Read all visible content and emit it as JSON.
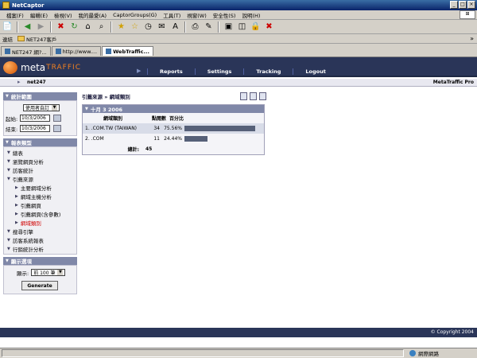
{
  "window": {
    "title": "NetCaptor",
    "buttons": [
      "_",
      "□",
      "×"
    ]
  },
  "menu": [
    "檔案(F)",
    "編輯(E)",
    "檢視(V)",
    "我的最愛(A)",
    "CaptorGroups(G)",
    "工具(T)",
    "視窗(W)",
    "安全性(S)",
    "說明(H)"
  ],
  "toolbar_icons": [
    "new-doc-icon",
    "back-icon",
    "forward-icon",
    "stop-icon",
    "refresh-icon",
    "home-icon",
    "search-icon",
    "favorites-icon",
    "add-favorite-icon",
    "history-icon",
    "mail-icon",
    "font-icon",
    "print-icon",
    "edit-icon",
    "window-icon",
    "lock-icon",
    "close-icon"
  ],
  "linkbar": {
    "label": "連結",
    "folder": "NET247客戶"
  },
  "tabs": [
    {
      "label": "NET247 網?..."
    },
    {
      "label": "http://www...."
    },
    {
      "label": "WebTraffic..."
    }
  ],
  "app": {
    "logo_meta": "meta",
    "logo_traffic": "TRAFFIC",
    "nav": [
      "Reports",
      "Settings",
      "Tracking",
      "Logout"
    ],
    "org": "net247",
    "product": "MetaTraffic Pro"
  },
  "sidebar": {
    "stats_header": "統計範圍",
    "range_select": "使用者自訂",
    "start_label": "起始:",
    "start_date": "10/3/2006",
    "end_label": "結束:",
    "end_date": "10/3/2006",
    "report_header": "報表類型",
    "items": [
      {
        "label": "總表",
        "level": 0,
        "active": false
      },
      {
        "label": "瀏覽網頁分析",
        "level": 0,
        "active": false
      },
      {
        "label": "訪客統計",
        "level": 0,
        "active": false
      },
      {
        "label": "引薦來源",
        "level": 0,
        "active": false
      },
      {
        "label": "主要網域分析",
        "level": 1,
        "active": false
      },
      {
        "label": "網域主機分析",
        "level": 1,
        "active": false
      },
      {
        "label": "引薦網頁",
        "level": 1,
        "active": false
      },
      {
        "label": "引薦網頁(含參數)",
        "level": 1,
        "active": false
      },
      {
        "label": "網域類別",
        "level": 1,
        "active": true
      },
      {
        "label": "搜尋引擎",
        "level": 0,
        "active": false
      },
      {
        "label": "訪客系統報表",
        "level": 0,
        "active": false
      },
      {
        "label": "行銷統計分析",
        "level": 0,
        "active": false
      }
    ],
    "display_header": "顯示選項",
    "display_label": "顯示:",
    "display_select": "前 100 筆",
    "generate": "Generate"
  },
  "main": {
    "breadcrumb": "引薦來源 » 網域類別",
    "panel_title": "十月 3 2006",
    "col_domain": "網域類別",
    "col_hits": "點閱數",
    "col_pct": "百分比",
    "rows": [
      {
        "index": "1.",
        "domain": ".COM.TW (TAIWAN)",
        "hits": "34",
        "pct": "75.56%",
        "ratio": 0.7556
      },
      {
        "index": "2.",
        "domain": ".COM",
        "hits": "11",
        "pct": "24.44%",
        "ratio": 0.2444
      }
    ],
    "total_label": "總計:",
    "total_value": "45"
  },
  "footer": {
    "copyright": "© Copyright 2004"
  },
  "status": {
    "zone": "網際網路"
  }
}
